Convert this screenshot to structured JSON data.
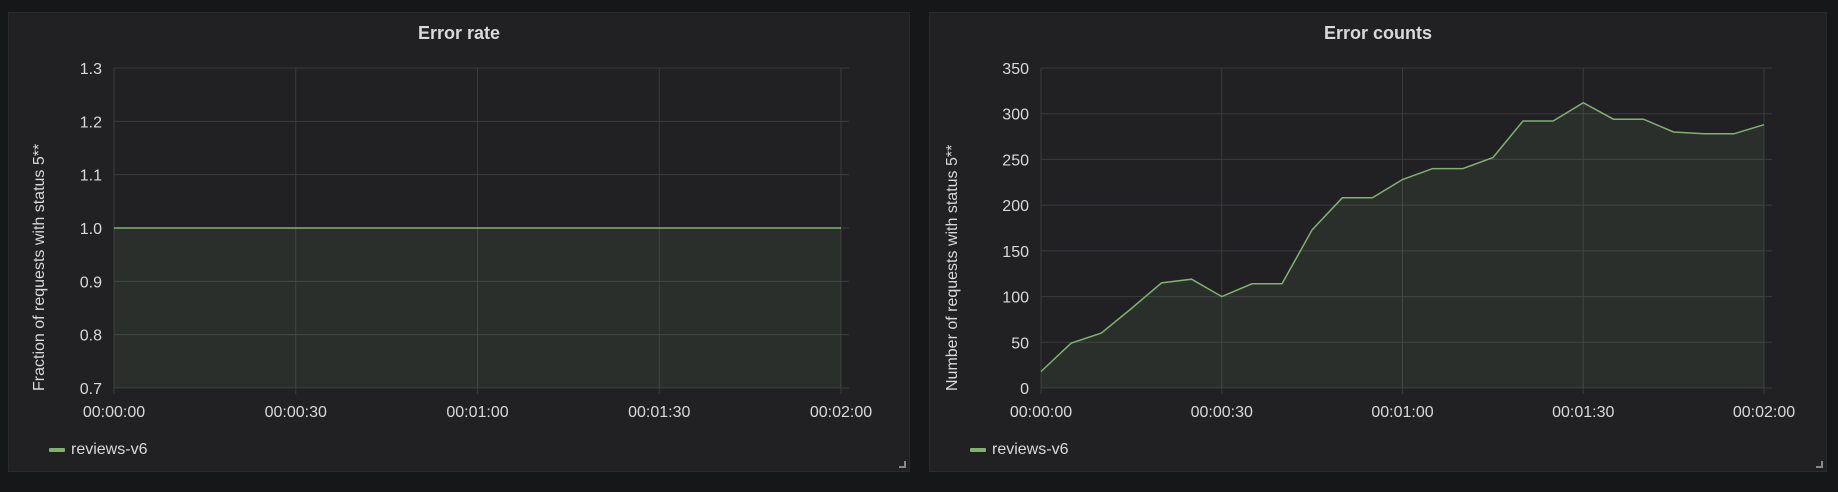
{
  "colors": {
    "series": "#7eb26d",
    "background": "#161719",
    "panel": "#212124",
    "grid": "#3b3b3e",
    "text": "#d8d9da"
  },
  "chart_data": [
    {
      "type": "area",
      "title": "Error rate",
      "ylabel": "Fraction of requests with status 5**",
      "xlabel": "",
      "ylim": [
        0.7,
        1.3
      ],
      "yticks": [
        "0.7",
        "0.8",
        "0.9",
        "1.0",
        "1.1",
        "1.2",
        "1.3"
      ],
      "xticks": [
        "00:00:00",
        "00:00:30",
        "00:01:00",
        "00:01:30",
        "00:02:00"
      ],
      "x": [
        "00:00:00",
        "00:02:00"
      ],
      "series": [
        {
          "name": "reviews-v6",
          "values": [
            1.0,
            1.0
          ]
        }
      ],
      "grid": true,
      "legend": "bottom-left"
    },
    {
      "type": "area",
      "title": "Error counts",
      "ylabel": "Number of requests with status 5**",
      "xlabel": "",
      "ylim": [
        0,
        350
      ],
      "yticks": [
        "0",
        "50",
        "100",
        "150",
        "200",
        "250",
        "300",
        "350"
      ],
      "xticks": [
        "00:00:00",
        "00:00:30",
        "00:01:00",
        "00:01:30",
        "00:02:00"
      ],
      "x": [
        "00:00:00",
        "00:00:05",
        "00:00:10",
        "00:00:15",
        "00:00:20",
        "00:00:25",
        "00:00:30",
        "00:00:35",
        "00:00:40",
        "00:00:45",
        "00:00:50",
        "00:00:55",
        "00:01:00",
        "00:01:05",
        "00:01:10",
        "00:01:15",
        "00:01:20",
        "00:01:25",
        "00:01:30",
        "00:01:35",
        "00:01:40",
        "00:01:45",
        "00:01:50",
        "00:01:55",
        "00:02:00"
      ],
      "series": [
        {
          "name": "reviews-v6",
          "values": [
            18,
            49,
            60,
            87,
            115,
            119,
            100,
            114,
            114,
            173,
            208,
            208,
            228,
            240,
            240,
            252,
            292,
            292,
            312,
            294,
            294,
            280,
            278,
            278,
            288
          ]
        }
      ],
      "grid": true,
      "legend": "bottom-left"
    }
  ]
}
